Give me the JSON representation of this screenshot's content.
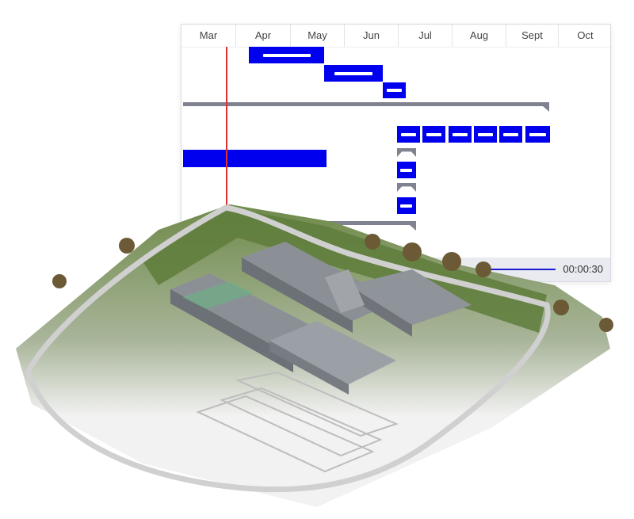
{
  "gantt": {
    "months": [
      "Mar",
      "Apr",
      "May",
      "Jun",
      "Jul",
      "Aug",
      "Sept",
      "Oct"
    ],
    "time_readout": "00:00:30",
    "colors": {
      "task": "#0000ee",
      "summary": "#80838f",
      "today_line": "#e03030"
    }
  }
}
